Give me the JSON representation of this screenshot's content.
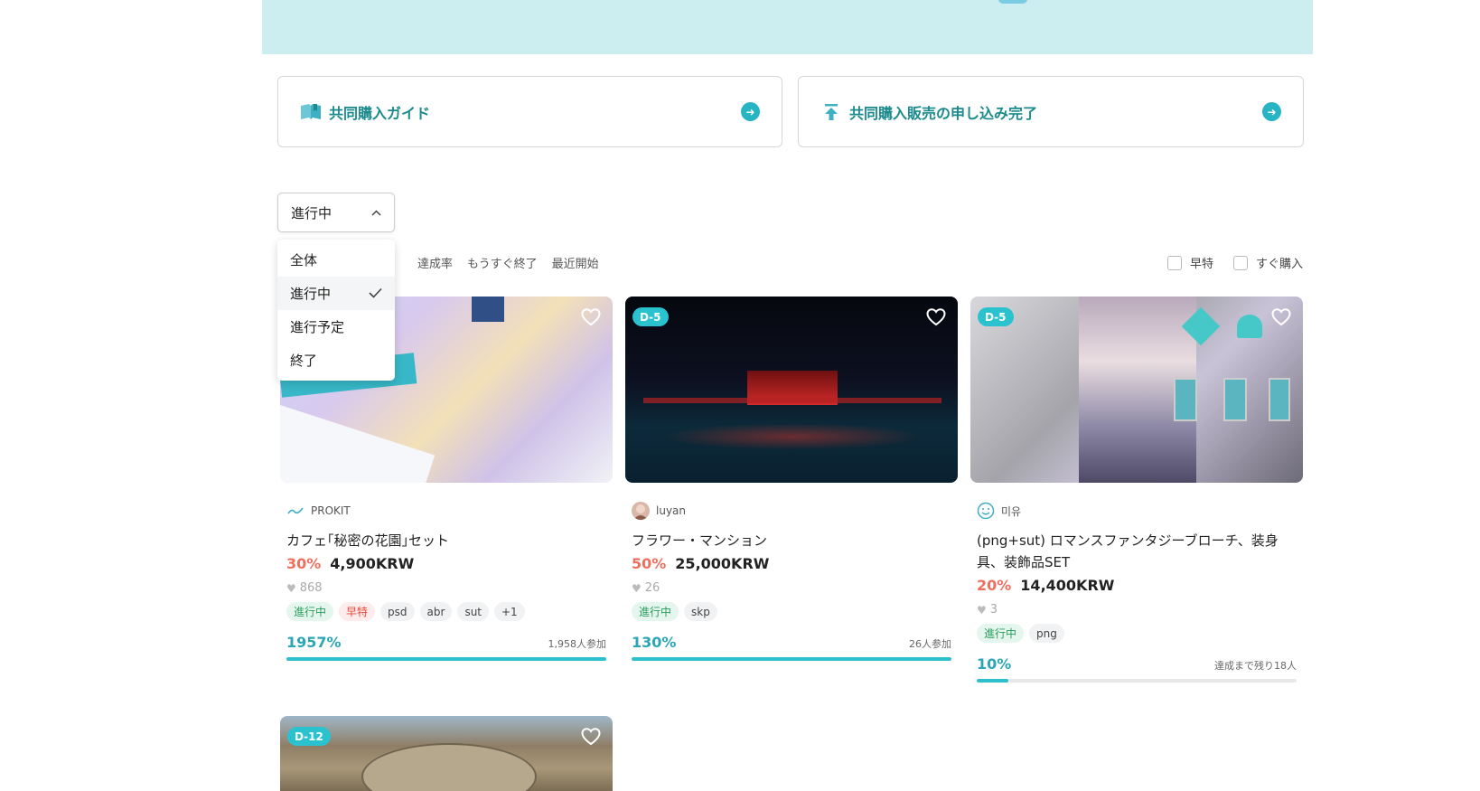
{
  "guides": [
    {
      "label": "共同購入ガイド",
      "icon": "book-icon"
    },
    {
      "label": "共同購入販売の申し込み完了",
      "icon": "upload-arrow-icon"
    }
  ],
  "status_select": {
    "value": "進行中",
    "options": [
      "全体",
      "進行中",
      "進行予定",
      "終了"
    ],
    "selected_index": 1
  },
  "sort_options": [
    "達成率",
    "もうすぐ終了",
    "最近開始"
  ],
  "filters": [
    {
      "label": "早特",
      "checked": false
    },
    {
      "label": "すぐ購入",
      "checked": false
    }
  ],
  "products": [
    {
      "dday": "",
      "seller": "PROKIT",
      "title": "カフェ｢秘密の花園｣セット",
      "discount": "30%",
      "price": "4,900KRW",
      "likes": "868",
      "tags": [
        "進行中",
        "早特",
        "psd",
        "abr",
        "sut",
        "+1"
      ],
      "percent": "1957%",
      "progress": 1.0,
      "participants": "1,958人参加"
    },
    {
      "dday": "D-5",
      "seller": "luyan",
      "title": "フラワー・マンション",
      "discount": "50%",
      "price": "25,000KRW",
      "likes": "26",
      "tags": [
        "進行中",
        "skp"
      ],
      "percent": "130%",
      "progress": 1.0,
      "participants": "26人参加"
    },
    {
      "dday": "D-5",
      "seller": "미유",
      "title": "(png+sut) ロマンスファンタジーブローチ、装身具、装飾品SET",
      "discount": "20%",
      "price": "14,400KRW",
      "likes": "3",
      "tags": [
        "進行中",
        "png"
      ],
      "percent": "10%",
      "progress": 0.1,
      "participants": "達成まで残り18人"
    },
    {
      "dday": "D-12"
    }
  ],
  "colors": {
    "accent": "#2bc0cc",
    "banner": "#cdeef0",
    "discount": "#ef6f5e",
    "guide_text": "#1a8a8c"
  }
}
